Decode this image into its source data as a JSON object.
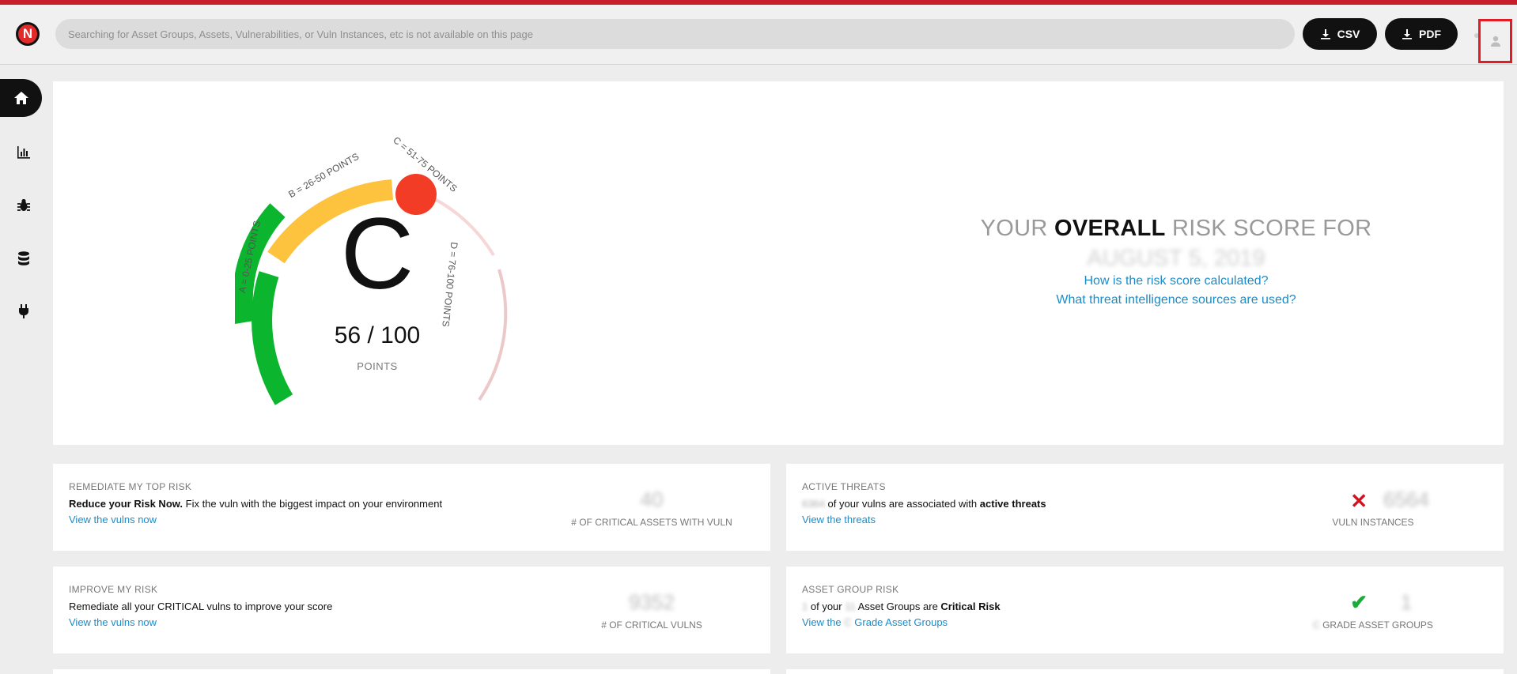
{
  "header": {
    "search_placeholder": "Searching for Asset Groups, Assets, Vulnerabilities, or Vuln Instances, etc is not available on this page",
    "csv_label": "CSV",
    "pdf_label": "PDF",
    "logo_letter": "N"
  },
  "sidebar": {
    "items": [
      {
        "icon": "home-icon",
        "active": true
      },
      {
        "icon": "bar-chart-icon",
        "active": false
      },
      {
        "icon": "bug-icon",
        "active": false
      },
      {
        "icon": "database-icon",
        "active": false
      },
      {
        "icon": "plug-icon",
        "active": false
      }
    ]
  },
  "gauge": {
    "grade": "C",
    "score": "56 / 100",
    "points_label": "POINTS",
    "segments": [
      {
        "label": "A = 0-25 POINTS",
        "color": "#0cb52e"
      },
      {
        "label": "B = 26-50 POINTS",
        "color": "#fdc23e"
      },
      {
        "label": "C = 51-75 POINTS",
        "color": "#f6d6d6"
      },
      {
        "label": "D = 76-100 POINTS",
        "color": "#ecc9c9"
      }
    ],
    "indicator_color": "#f23c26"
  },
  "risk": {
    "title_prefix": "YOUR",
    "title_bold": "OVERALL",
    "title_suffix": "RISK SCORE FOR",
    "date": "AUGUST 5, 2019",
    "link_calc": "How is the risk score calculated?",
    "link_sources": "What threat intelligence sources are used?"
  },
  "cards": {
    "remediate": {
      "title": "REMEDIATE MY TOP RISK",
      "text_bold": "Reduce your Risk Now.",
      "text": "Fix the vuln with the biggest impact on your environment",
      "link": "View the vulns now",
      "metric_value": "40",
      "metric_label": "# OF CRITICAL ASSETS WITH VULN"
    },
    "threats": {
      "title": "ACTIVE THREATS",
      "text_blur": "6364",
      "text": "of your vulns are associated with",
      "text_bold": "active threats",
      "link": "View the threats",
      "metric_value": "6564",
      "metric_label": "VULN INSTANCES"
    },
    "improve": {
      "title": "IMPROVE MY RISK",
      "text": "Remediate all your CRITICAL vulns to improve your score",
      "link": "View the vulns now",
      "metric_value": "9352",
      "metric_label": "# OF CRITICAL VULNS"
    },
    "asset_group": {
      "title": "ASSET GROUP RISK",
      "text_blur1": "1",
      "text_mid1": "of your",
      "text_blur2": "11",
      "text_mid2": "Asset Groups are",
      "text_bold": "Critical Risk",
      "link_prefix": "View the",
      "link_blur": "C",
      "link_suffix": "Grade Asset Groups",
      "metric_value": "1",
      "metric_label_blur": "C",
      "metric_label": "GRADE ASSET GROUPS"
    }
  }
}
